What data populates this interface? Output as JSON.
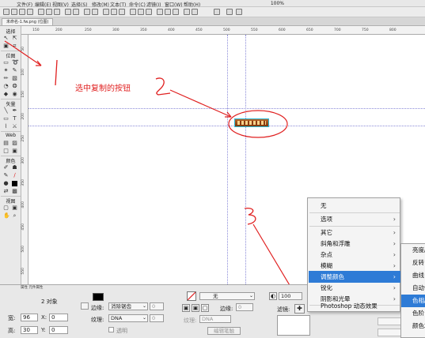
{
  "menubar": {
    "items": [
      "文件(F)",
      "编辑(E)",
      "视图(V)",
      "选择(S)",
      "修改(M)",
      "文本(T)",
      "命令(C)",
      "滤镜(I)",
      "窗口(W)",
      "帮助(H)"
    ],
    "zoom": "100%"
  },
  "document": {
    "tab_label": "未命名-1.fw.png (位图)",
    "view_tabs": [
      "原始",
      "预览",
      "2幅",
      "4幅"
    ]
  },
  "tools": {
    "select_label": "选择",
    "bitmap_label": "位图",
    "vector_label": "矢量",
    "web_label": "Web",
    "color_label": "颜色",
    "view_label": "视图"
  },
  "ruler": {
    "top_ticks": [
      "150",
      "200",
      "250",
      "300",
      "350",
      "400",
      "450",
      "500",
      "550",
      "600",
      "650",
      "700",
      "750",
      "800"
    ],
    "left_ticks": [
      "50",
      "100",
      "150",
      "200",
      "250",
      "300",
      "350",
      "400",
      "450",
      "500",
      "550"
    ]
  },
  "annotations": {
    "label_1": "1",
    "label_2_text": "选中复制的按钮",
    "label_2": "2",
    "label_3": "3"
  },
  "properties": {
    "tabs": "属性 元件属性",
    "object_count": "2 对象",
    "edge_label": "边缘:",
    "edge_value": "消除锯齿",
    "edge_amount": "0",
    "texture_label": "纹理:",
    "texture_value": "DNA",
    "texture_amount": "0",
    "transparent_label": "透明",
    "fill_none": "无",
    "stroke_label": "边缘:",
    "stroke_amount": "0",
    "stroke_texture_label": "纹理:",
    "stroke_texture_value": "DNA",
    "edit_stroke_label": "编辑笔触",
    "opacity_value": "100",
    "filters_label": "滤镜:",
    "width_label": "宽:",
    "width_value": "96",
    "height_label": "高:",
    "height_value": "30",
    "x_label": "X:",
    "x_value": "0",
    "y_label": "Y:",
    "y_value": "0"
  },
  "filter_menu": {
    "items": [
      {
        "label": "无",
        "has_sub": false
      },
      {
        "label": "选项",
        "has_sub": true
      },
      {
        "label": "其它",
        "has_sub": true
      },
      {
        "label": "斜角和浮雕",
        "has_sub": true
      },
      {
        "label": "杂点",
        "has_sub": true
      },
      {
        "label": "模糊",
        "has_sub": true
      },
      {
        "label": "调整颜色",
        "has_sub": true,
        "highlighted": true
      },
      {
        "label": "锐化",
        "has_sub": true
      },
      {
        "label": "阴影和光晕",
        "has_sub": true
      },
      {
        "label": "Photoshop 动态效果",
        "has_sub": false
      }
    ],
    "submenu": [
      {
        "label": "亮度/对比度"
      },
      {
        "label": "反转"
      },
      {
        "label": "曲线"
      },
      {
        "label": "自动色阶"
      },
      {
        "label": "色相/饱和度",
        "highlighted": true
      },
      {
        "label": "色阶"
      },
      {
        "label": "颜色填充"
      }
    ]
  },
  "colors": {
    "accent": "#2e7bd6",
    "annotation": "#e02020",
    "guide": "#8a8ad8"
  }
}
